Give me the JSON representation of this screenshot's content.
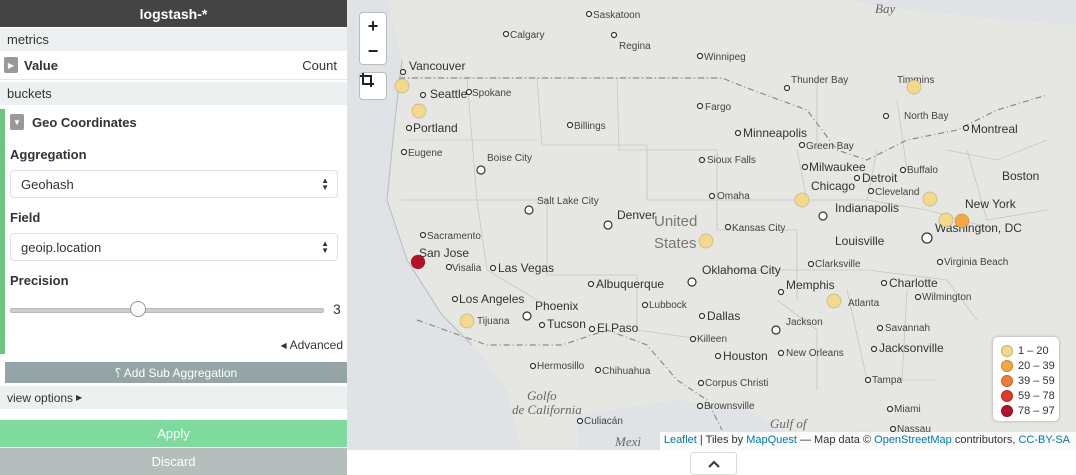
{
  "sidebar": {
    "index_title": "logstash-*",
    "metrics_label": "metrics",
    "value_name": "Value",
    "value_agg": "Count",
    "buckets_label": "buckets",
    "geo_title": "Geo Coordinates",
    "aggregation_label": "Aggregation",
    "aggregation_value": "Geohash",
    "field_label": "Field",
    "field_value": "geoip.location",
    "precision_label": "Precision",
    "precision_value": "3",
    "precision_level": 0.4,
    "advanced_label": "Advanced",
    "add_sub_label": "⸮ Add Sub Aggregation",
    "view_options_label": "view options",
    "apply_label": "Apply",
    "discard_label": "Discard"
  },
  "map": {
    "zoom_in": "+",
    "zoom_out": "−",
    "labels": {
      "bay": "Bay",
      "saskatoon": "Saskatoon",
      "calgary": "Calgary",
      "regina": "Regina",
      "winnipeg": "Winnipeg",
      "thunder_bay": "Thunder Bay",
      "timmins": "Timmins",
      "vancouver": "Vancouver",
      "seattle": "Seattle",
      "spokane": "Spokane",
      "portland": "Portland",
      "billings": "Billings",
      "fargo": "Fargo",
      "north_bay": "North Bay",
      "montreal": "Montreal",
      "eugene": "Eugene",
      "boise": "Boise City",
      "minneapolis": "Minneapolis",
      "green_bay": "Green Bay",
      "sioux_falls": "Sioux Falls",
      "milwaukee": "Milwaukee",
      "buffalo": "Buffalo",
      "boston": "Boston",
      "detroit": "Detroit",
      "chicago": "Chicago",
      "cleveland": "Cleveland",
      "salt_lake": "Salt Lake City",
      "omaha": "Omaha",
      "indianapolis": "Indianapolis",
      "new_york": "New York",
      "denver": "Denver",
      "united": "United",
      "states": "States",
      "kansas_city": "Kansas City",
      "sacramento": "Sacramento",
      "washington": "Washington, DC",
      "san_jose": "San Jose",
      "louisville": "Louisville",
      "visalia": "Visalia",
      "las_vegas": "Las Vegas",
      "oklahoma": "Oklahoma City",
      "virginia_beach": "Virginia Beach",
      "clarksville": "Clarksville",
      "charlotte": "Charlotte",
      "albuquerque": "Albuquerque",
      "memphis": "Memphis",
      "los_angeles": "Los Angeles",
      "lubbock": "Lubbock",
      "wilmington": "Wilmington",
      "phoenix": "Phoenix",
      "atlanta": "Atlanta",
      "tijuana": "Tijuana",
      "tucson": "Tucson",
      "el_paso": "El Paso",
      "dallas": "Dallas",
      "jackson": "Jackson",
      "savannah": "Savannah",
      "killeen": "Killeen",
      "jacksonville": "Jacksonville",
      "houston": "Houston",
      "new_orleans": "New Orleans",
      "hermosillo": "Hermosillo",
      "chihuahua": "Chihuahua",
      "corpus": "Corpus Christi",
      "tampa": "Tampa",
      "golfo1": "Golfo",
      "golfo2": "de California",
      "brownsville": "Brownsville",
      "culiacan": "Culiacán",
      "miami": "Miami",
      "gulf1": "Gulf of",
      "nassau": "Nassau",
      "mexi": "Mexi"
    },
    "legend": [
      "1 – 20",
      "20 – 39",
      "39 – 59",
      "59 – 78",
      "78 – 97"
    ],
    "legend_colors": [
      "#f5d98a",
      "#f4a742",
      "#ef7d36",
      "#e03a2c",
      "#b3102a"
    ],
    "attribution": {
      "leaflet": "Leaflet",
      "sep1": " | Tiles by ",
      "mapquest": "MapQuest",
      "sep2": " — Map data © ",
      "osm": "OpenStreetMap",
      "sep3": " contributors, ",
      "license": "CC-BY-SA"
    }
  }
}
